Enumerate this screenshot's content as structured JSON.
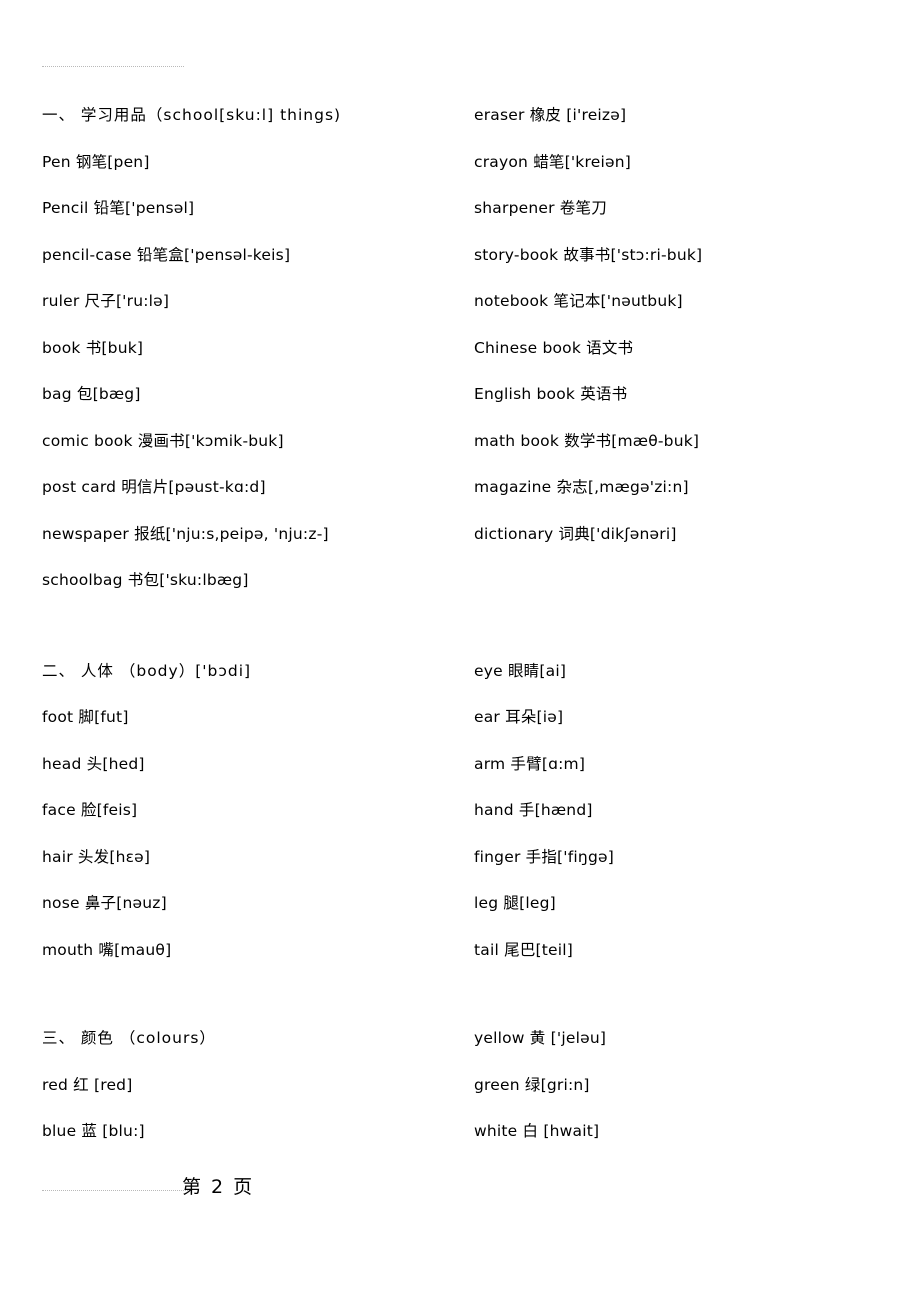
{
  "document": {
    "footer_page_label": "第 2 页"
  },
  "sections": [
    {
      "id": "school-things",
      "heading": "一、 学习用品（school[sku:l] things)",
      "left": [
        "Pen 钢笔[pen]",
        "Pencil 铅笔['pensəl]",
        "pencil-case 铅笔盒['pensəl-keis]",
        "ruler 尺子['ru:lə]",
        "book 书[buk]",
        "bag 包[bæg]",
        "comic book 漫画书['kɔmik-buk]",
        "post card 明信片[pəust-kɑ:d]",
        "newspaper 报纸['nju:s,peipə, 'nju:z-]",
        "schoolbag 书包['sku:lbæg]"
      ],
      "right": [
        "eraser 橡皮 [i'reizə]",
        "crayon 蜡笔['kreiən]",
        "sharpener 卷笔刀",
        "story-book 故事书['stɔ:ri-buk]",
        "notebook 笔记本['nəutbuk]",
        "Chinese book 语文书",
        "English book 英语书",
        "math book 数学书[mæθ-buk]",
        "magazine 杂志[,mægə'zi:n]",
        "dictionary 词典['dikʃənəri]"
      ]
    },
    {
      "id": "body",
      "heading": "二、 人体 （body）['bɔdi]",
      "left": [
        "foot 脚[fut]",
        "head 头[hed]",
        "face 脸[feis]",
        "hair 头发[hεə]",
        "nose 鼻子[nəuz]",
        "mouth 嘴[mauθ]"
      ],
      "right": [
        "eye 眼睛[ai]",
        "ear 耳朵[iə]",
        "arm 手臂[ɑ:m]",
        "hand 手[hænd]",
        "finger 手指['fiŋgə]",
        "leg 腿[leg]",
        "tail 尾巴[teil]"
      ]
    },
    {
      "id": "colours",
      "heading": "三、 颜色 （colours）",
      "left": [
        "red 红 [red]",
        "blue 蓝 [blu:]"
      ],
      "right": [
        "yellow 黄 ['jeləu]",
        "green 绿[gri:n]",
        "white 白 [hwait]"
      ]
    }
  ]
}
